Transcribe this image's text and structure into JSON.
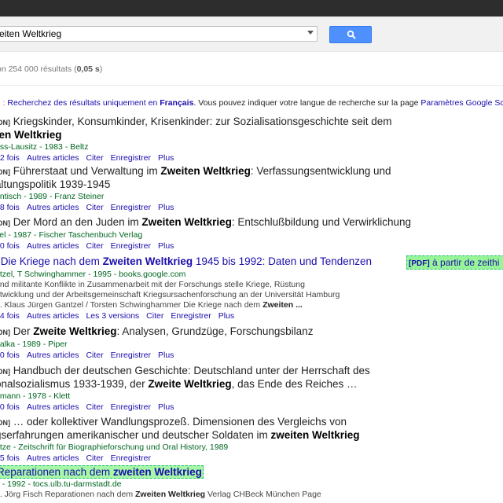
{
  "search": {
    "query": "eiten Weltkrieg"
  },
  "stats": {
    "prefix": "on 254 000 résultats (",
    "time": "0,05 s",
    "suffix": ")"
  },
  "lang_note": {
    "lead": "il : ",
    "link1": "Recherchez des résultats uniquement en",
    "lang": "Français",
    "middle": ". Vous pouvez indiquer votre langue de recherche sur la page",
    "link2": "Paramètres Google Scholar",
    "tail": "."
  },
  "results": [
    {
      "tag": "ION]",
      "title_a": " Kriegskinder, Konsumkinder, Krisenkinder: zur Sozialisationsgeschichte seit dem",
      "title_line2_bold": "ten Weltkrieg",
      "meta": "uss-Lausitz - 1983 - Beltz",
      "links": [
        "02 fois",
        "Autres articles",
        "Citer",
        "Enregistrer",
        "Plus"
      ]
    },
    {
      "tag": "ION]",
      "title_a": " Führerstaat und Verwaltung im ",
      "title_b": "Zweiten Weltkrieg",
      "title_c": ": Verfassungsentwicklung und",
      "title_line2": "altungspolitik 1939-1945",
      "meta": "entisch - 1989 - Franz Steiner",
      "links": [
        "28 fois",
        "Autres articles",
        "Citer",
        "Enregistrer",
        "Plus"
      ]
    },
    {
      "tag": "ION]",
      "title_a": " Der Mord an den Juden im ",
      "title_b": "Zweiten Weltkrieg",
      "title_c": ": Entschlußbildung und Verwirklichung",
      "meta": "kel - 1987 - Fischer Taschenbuch Verlag",
      "links": [
        "40 fois",
        "Autres articles",
        "Citer",
        "Enregistrer",
        "Plus"
      ]
    },
    {
      "tag": "]",
      "title_a": " Die Kriege nach dem ",
      "title_b": "Zweiten Weltkrieg",
      "title_c": " 1945 bis 1992: Daten und Tendenzen",
      "meta": "ntzel, T Schwinghammer - 1995 - books.google.com",
      "snippet1": "und militante Konflikte in Zusammenarbeit mit der Forschungs stelle Kriege, Rüstung",
      "snippet2": "ntwicklung und der Arbeitsgemeinschaft Kriegsursachenforschung an der Universität Hamburg",
      "snippet3_a": "... Klaus Jürgen Gantzel / Torsten Schwinghammer Die Kriege nach dem ",
      "snippet3_b": "Zweiten ...",
      "links": [
        "64 fois",
        "Autres articles",
        "Les 3 versions",
        "Citer",
        "Enregistrer",
        "Plus"
      ],
      "side_tag": "[PDF]",
      "side_text": " à partir de zeithi"
    },
    {
      "tag": "ION]",
      "title_a": " Der ",
      "title_b": "Zweite Weltkrieg",
      "title_c": ": Analysen, Grundzüge, Forschungsbilanz",
      "meta": "halka - 1989 - Piper",
      "links": [
        "60 fois",
        "Autres articles",
        "Citer",
        "Enregistrer",
        "Plus"
      ]
    },
    {
      "tag": "ION]",
      "title_a": " Handbuch der deutschen Geschichte: Deutschland unter der Herrschaft des",
      "title_line2_a": "onalsozialismus 1933-1939, der ",
      "title_line2_b": "Zweite Weltkrieg",
      "title_line2_c": ", das Ende des Reiches …",
      "meta": "dmann - 1978 - Klett",
      "links": [
        "20 fois",
        "Autres articles",
        "Citer",
        "Enregistrer",
        "Plus"
      ]
    },
    {
      "tag": "ION]",
      "title_a": " … oder kollektiver Wandlungsprozeß. Dimensionen des Vergleichs von",
      "title_line2_a": "gserfahrungen amerikanischer und deutscher Soldaten im ",
      "title_line2_b": "zweiten Weltkrieg",
      "meta": "ütze - Zeitschrift für Biographieforschung und Oral History, 1989",
      "links": [
        "35 fois",
        "Autres articles",
        "Citer",
        "Enregistrer"
      ]
    },
    {
      "title_a": "Reparationen nach dem ",
      "title_b": "zweiten Weltkrieg",
      "meta": "h - 1992 - tocs.ulb.tu-darmstadt.de",
      "snippet1_a": "1. Jörg Fisch Reparationen nach dem ",
      "snippet1_b": "Zweiten Weltkrieg",
      "snippet1_c": " Verlag CHBeck München Page"
    }
  ]
}
